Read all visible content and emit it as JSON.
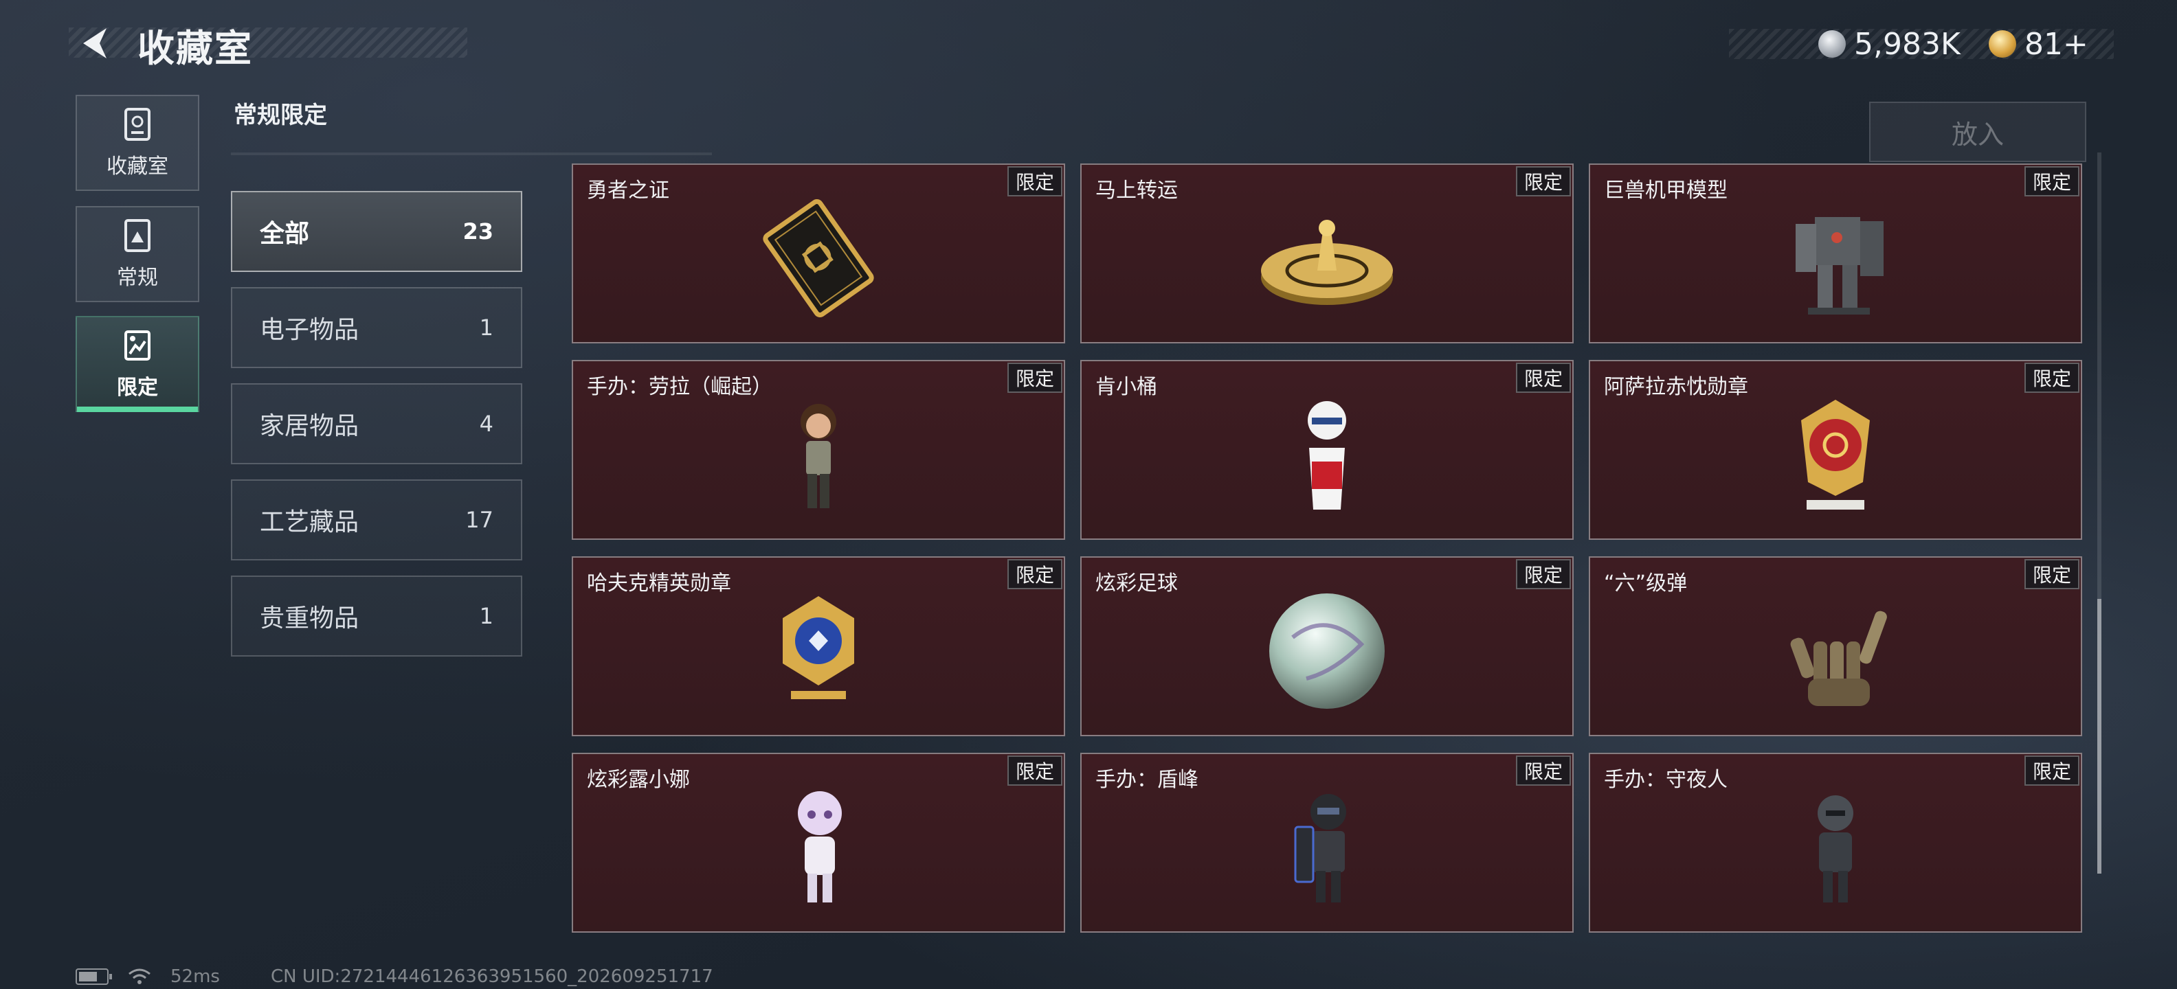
{
  "header": {
    "title": "收藏室",
    "currency_silver": "5,983K",
    "currency_gold": "81+"
  },
  "nav": {
    "tabs": [
      {
        "label": "收藏室",
        "icon": "collection-room-icon"
      },
      {
        "label": "常规",
        "icon": "regular-icon"
      },
      {
        "label": "限定",
        "icon": "limited-icon",
        "active": true
      }
    ]
  },
  "section": {
    "title": "常规限定"
  },
  "categories": [
    {
      "label": "全部",
      "count": "23",
      "active": true
    },
    {
      "label": "电子物品",
      "count": "1"
    },
    {
      "label": "家居物品",
      "count": "4"
    },
    {
      "label": "工艺藏品",
      "count": "17"
    },
    {
      "label": "贵重物品",
      "count": "1"
    }
  ],
  "put_button": "放入",
  "limited_tag": "限定",
  "items": [
    {
      "name": "勇者之证",
      "icon": "card-emblem-icon"
    },
    {
      "name": "马上转运",
      "icon": "golden-turntable-icon"
    },
    {
      "name": "巨兽机甲模型",
      "icon": "mech-model-icon"
    },
    {
      "name": "手办：劳拉（崛起）",
      "icon": "figure-lara-icon"
    },
    {
      "name": "肯小桶",
      "icon": "figure-kfc-icon"
    },
    {
      "name": "阿萨拉赤忱勋章",
      "icon": "medal-red-icon"
    },
    {
      "name": "哈夫克精英勋章",
      "icon": "medal-blue-icon"
    },
    {
      "name": "炫彩足球",
      "icon": "football-icon"
    },
    {
      "name": "“六”级弹",
      "icon": "bullet-hand-icon"
    },
    {
      "name": "炫彩露小娜",
      "icon": "figure-luna-icon"
    },
    {
      "name": "手办：盾峰",
      "icon": "figure-shield-icon"
    },
    {
      "name": "手办：守夜人",
      "icon": "figure-nightwatch-icon"
    }
  ],
  "status": {
    "ping": "52ms",
    "uid": "CN UID:27214446126363951560_202609251717"
  }
}
